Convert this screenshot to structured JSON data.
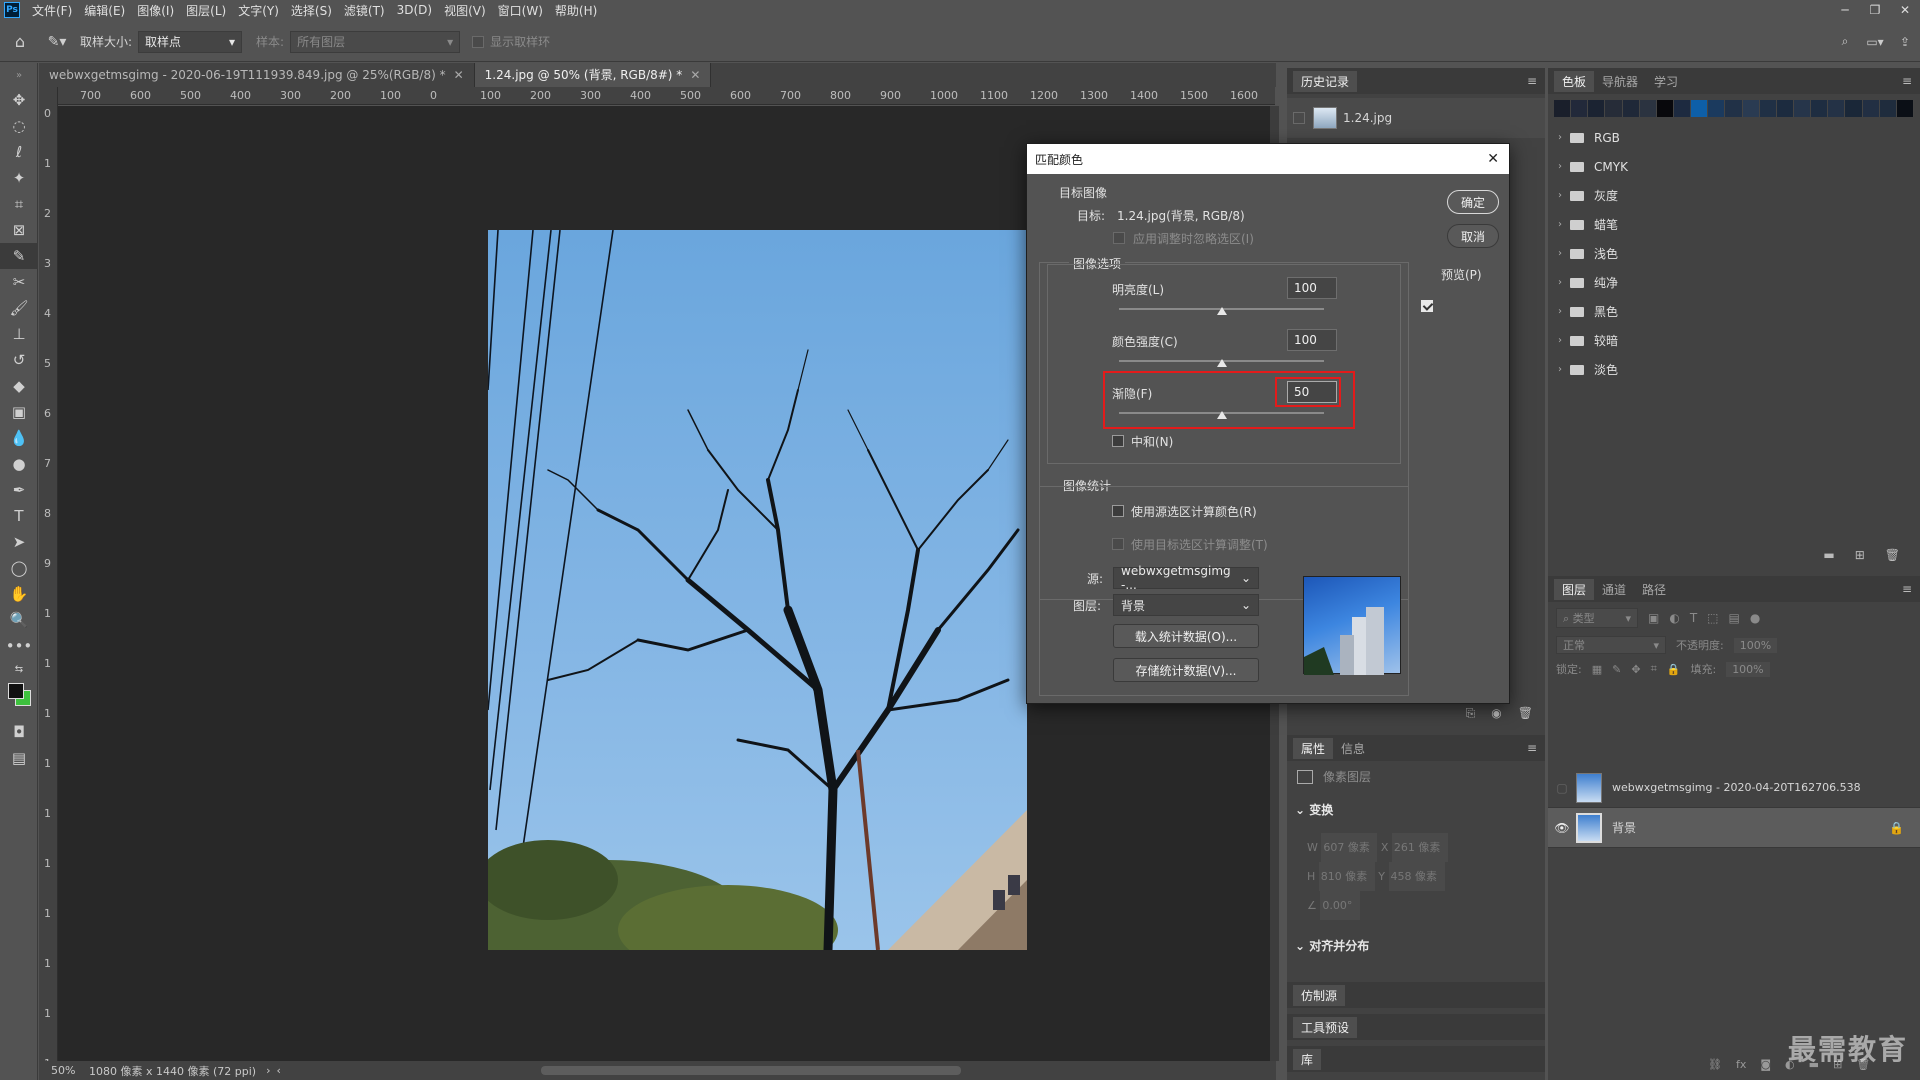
{
  "app": {
    "logo": "Ps"
  },
  "menu": [
    "文件(F)",
    "编辑(E)",
    "图像(I)",
    "图层(L)",
    "文字(Y)",
    "选择(S)",
    "滤镜(T)",
    "3D(D)",
    "视图(V)",
    "窗口(W)",
    "帮助(H)"
  ],
  "options": {
    "sample_size_label": "取样大小:",
    "sample_size_value": "取样点",
    "sample_label": "样本:",
    "sample_value": "所有图层",
    "show_ring_label": "显示取样环"
  },
  "tabs": [
    {
      "label": "webwxgetmsgimg - 2020-06-19T111939.849.jpg @ 25%(RGB/8) *",
      "active": false
    },
    {
      "label": "1.24.jpg @ 50% (背景, RGB/8#) *",
      "active": true
    }
  ],
  "ruler": {
    "h": [
      "700",
      "600",
      "500",
      "400",
      "300",
      "200",
      "100",
      "0",
      "100",
      "200",
      "300",
      "400",
      "500",
      "600",
      "700",
      "800",
      "900",
      "1000",
      "1100",
      "1200",
      "1300",
      "1400",
      "1500",
      "1600"
    ],
    "v": [
      "0",
      "1",
      "2",
      "3",
      "4",
      "5",
      "6",
      "7",
      "8",
      "9",
      "1",
      "1",
      "1",
      "1",
      "1",
      "1",
      "1",
      "1",
      "1",
      "1"
    ]
  },
  "status": {
    "zoom": "50%",
    "doc": "1080 像素 x 1440 像素 (72 ppi)"
  },
  "history": {
    "title": "历史记录",
    "item": "1.24.jpg"
  },
  "properties": {
    "tabs": [
      "属性",
      "信息"
    ],
    "kind": "像素图层",
    "transform": "变换",
    "w": "607 像素",
    "x": "261 像素",
    "h": "810 像素",
    "y": "458 像素",
    "angle": "0.00°",
    "align": "对齐并分布"
  },
  "collapsed": [
    "仿制源",
    "工具预设",
    "库"
  ],
  "swatches": {
    "tabs": [
      "色板",
      "导航器",
      "学习"
    ],
    "groups": [
      "RGB",
      "CMYK",
      "灰度",
      "蜡笔",
      "浅色",
      "纯净",
      "黑色",
      "较暗",
      "淡色"
    ],
    "colors": [
      "#1a1f2b",
      "#22293a",
      "#1b2332",
      "#262c38",
      "#1f2838",
      "#2b3340",
      "#08080c",
      "#1d2a40",
      "#0e5fa8",
      "#1b3a5e",
      "#213147",
      "#2a3b52",
      "#203045",
      "#1c2b3f",
      "#26354a",
      "#1e2d41",
      "#243246",
      "#1a2738",
      "#222f43",
      "#1f2c3d",
      "#0b0f16"
    ]
  },
  "layers": {
    "tabs": [
      "图层",
      "通道",
      "路径"
    ],
    "filter": "类型",
    "blend": "正常",
    "opacity_label": "不透明度:",
    "opacity": "100%",
    "lock_label": "锁定:",
    "fill_label": "填充:",
    "fill": "100%",
    "items": [
      {
        "name": "webwxgetmsgimg - 2020-04-20T162706.538",
        "visible": false,
        "locked": false
      },
      {
        "name": "背景",
        "visible": true,
        "locked": true
      }
    ]
  },
  "dialog": {
    "title": "匹配颜色",
    "target_group": "目标图像",
    "target_label": "目标:",
    "target_value": "1.24.jpg(背景, RGB/8)",
    "ignore_selection": "应用调整时忽略选区(I)",
    "options_group": "图像选项",
    "luminance_label": "明亮度(L)",
    "luminance": "100",
    "luminance_pos": 0.5,
    "intensity_label": "颜色强度(C)",
    "intensity": "100",
    "intensity_pos": 0.5,
    "fade_label": "渐隐(F)",
    "fade": "50",
    "fade_pos": 0.5,
    "neutralize": "中和(N)",
    "stats_group": "图像统计",
    "use_source_sel": "使用源选区计算颜色(R)",
    "use_target_sel": "使用目标选区计算调整(T)",
    "source_label": "源:",
    "source_value": "webwxgetmsgimg -...",
    "layer_label": "图层:",
    "layer_value": "背景",
    "load_btn": "载入统计数据(O)...",
    "save_btn": "存储统计数据(V)...",
    "ok": "确定",
    "cancel": "取消",
    "preview": "预览(P)"
  },
  "watermark": "最需教育"
}
